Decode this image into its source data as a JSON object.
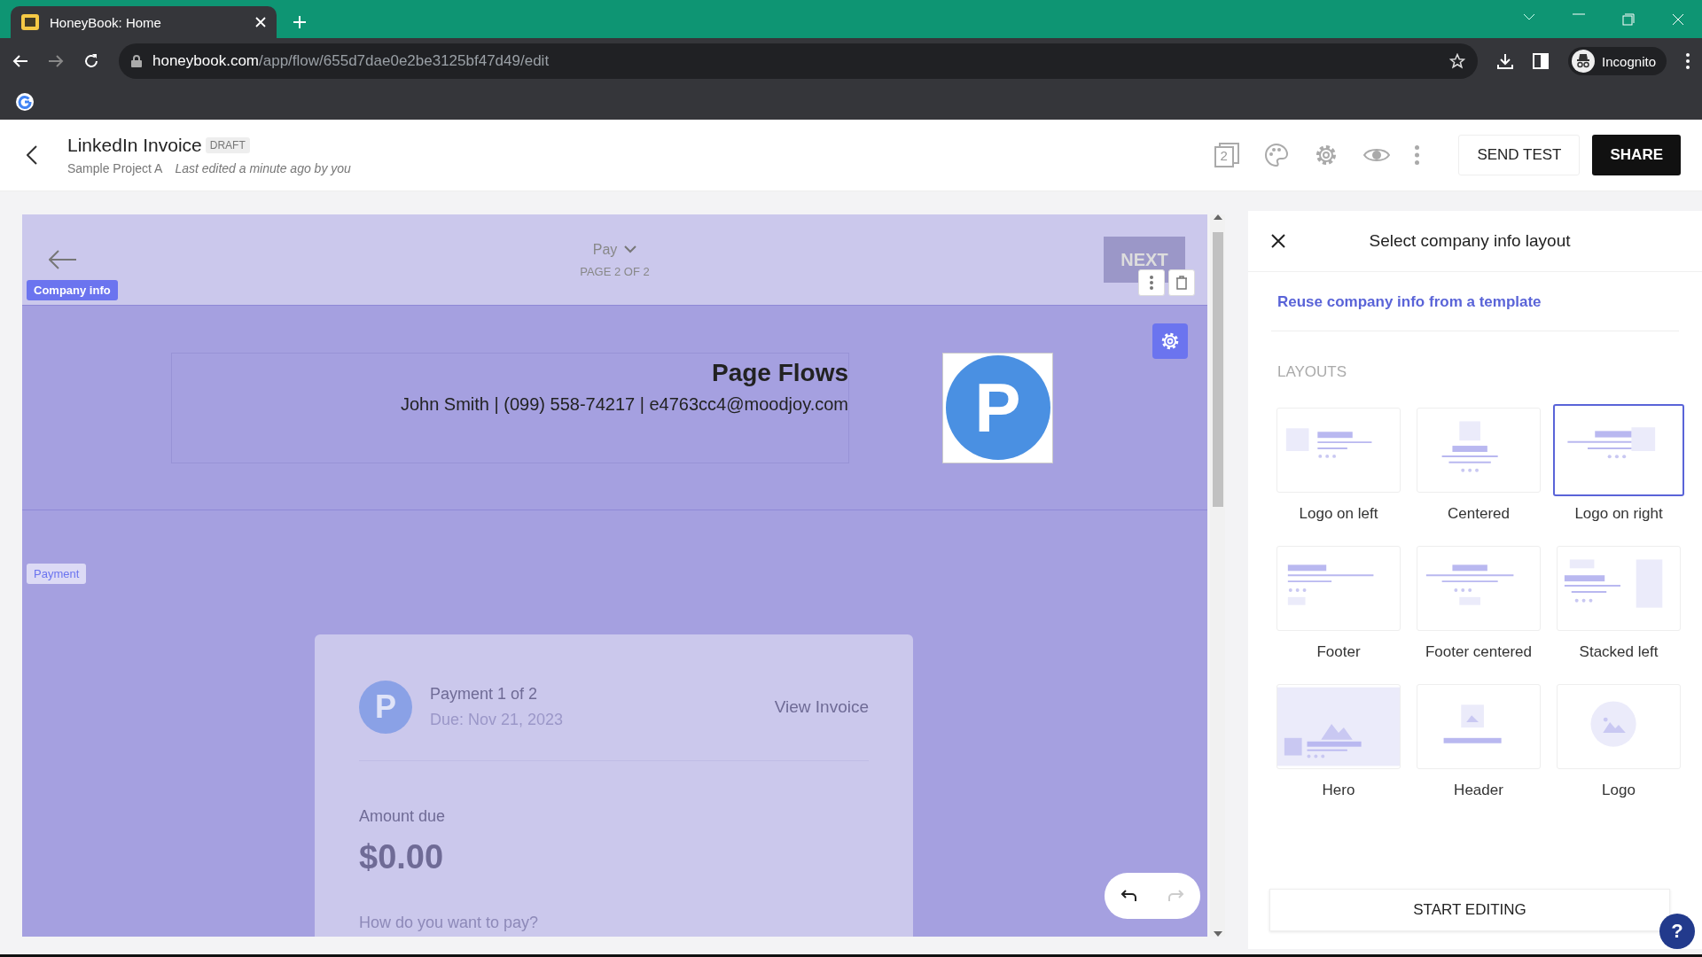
{
  "browser": {
    "tab_title": "HoneyBook: Home",
    "url_domain": "honeybook.com",
    "url_path": "/app/flow/655d7dae0e2be3125bf47d49/edit",
    "profile": "Incognito"
  },
  "header": {
    "title": "LinkedIn Invoice",
    "badge": "DRAFT",
    "project": "Sample Project A",
    "last_edited": "Last edited a minute ago by you",
    "page_count": "2",
    "send_test": "SEND TEST",
    "share": "SHARE"
  },
  "canvas": {
    "section": "Pay",
    "page": "PAGE 2 OF 2",
    "next": "NEXT",
    "company_label": "Company info",
    "payment_label": "Payment",
    "company": {
      "name": "Page Flows",
      "contact": "John Smith | (099) 558-74217 | e4763cc4@moodjoy.com",
      "logo_letter": "P"
    },
    "payment": {
      "avatar_letter": "P",
      "title": "Payment 1 of 2",
      "due": "Due: Nov 21, 2023",
      "view_invoice": "View Invoice",
      "amount_label": "Amount due",
      "amount": "$0.00",
      "question": "How do you want to pay?"
    },
    "history": {
      "can_undo": true,
      "can_redo": false
    }
  },
  "panel": {
    "title": "Select company info layout",
    "link": "Reuse company info from a template",
    "section": "LAYOUTS",
    "layouts": [
      {
        "label": "Logo on left",
        "kind": "left",
        "selected": false
      },
      {
        "label": "Centered",
        "kind": "centered",
        "selected": false
      },
      {
        "label": "Logo on right",
        "kind": "right",
        "selected": true
      },
      {
        "label": "Footer",
        "kind": "footer",
        "selected": false
      },
      {
        "label": "Footer centered",
        "kind": "footer-centered",
        "selected": false
      },
      {
        "label": "Stacked left",
        "kind": "stacked",
        "selected": false
      },
      {
        "label": "Hero",
        "kind": "hero",
        "selected": false
      },
      {
        "label": "Header",
        "kind": "header",
        "selected": false
      },
      {
        "label": "Logo",
        "kind": "logo",
        "selected": false
      }
    ],
    "button": "START EDITING",
    "help": "?"
  }
}
